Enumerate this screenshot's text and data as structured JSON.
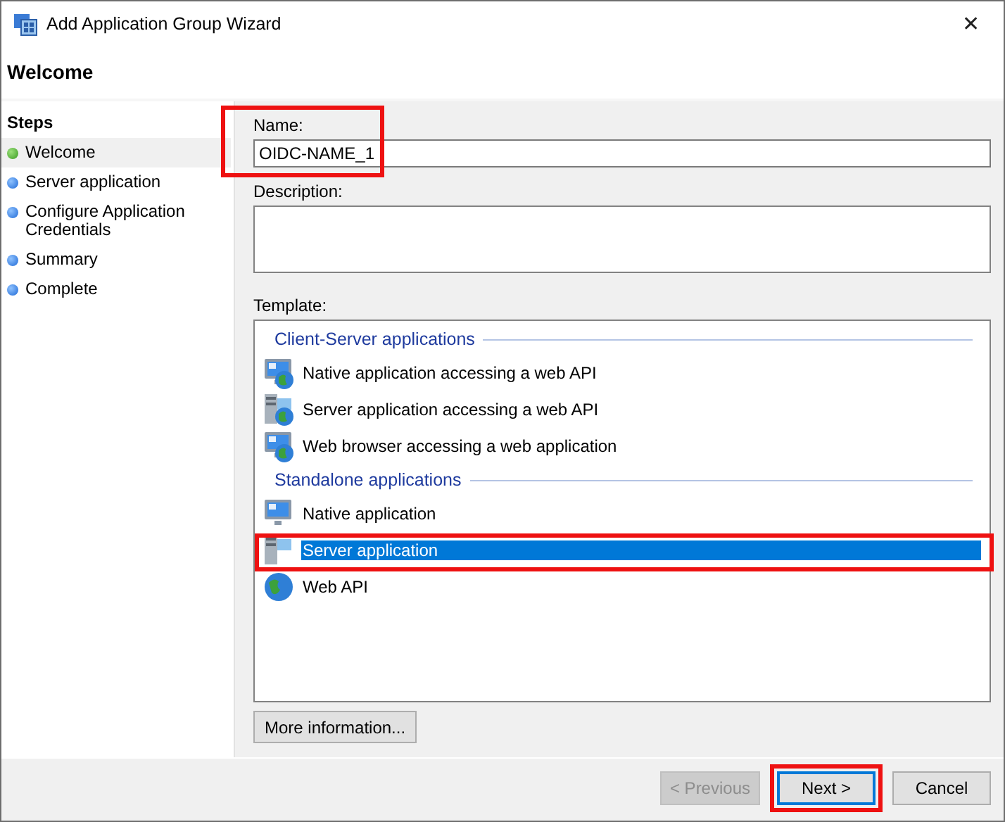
{
  "window": {
    "title": "Add Application Group Wizard",
    "close": "✕"
  },
  "page_title": "Welcome",
  "steps": {
    "heading": "Steps",
    "items": [
      {
        "label": "Welcome",
        "selected": true
      },
      {
        "label": "Server application",
        "selected": false
      },
      {
        "label": "Configure Application Credentials",
        "selected": false
      },
      {
        "label": "Summary",
        "selected": false
      },
      {
        "label": "Complete",
        "selected": false
      }
    ]
  },
  "name": {
    "label": "Name:",
    "value": "OIDC-NAME_1",
    "highlighted": true
  },
  "description": {
    "label": "Description:"
  },
  "template": {
    "label": "Template:",
    "groups": [
      {
        "heading": "Client-Server applications",
        "items": [
          {
            "label": "Native application accessing a web API",
            "kind": "monitor-globe",
            "selected": false,
            "highlighted": false
          },
          {
            "label": "Server application accessing a web API",
            "kind": "server-globe",
            "selected": false,
            "highlighted": false
          },
          {
            "label": "Web browser accessing a web application",
            "kind": "monitor-globe",
            "selected": false,
            "highlighted": false
          }
        ]
      },
      {
        "heading": "Standalone applications",
        "items": [
          {
            "label": "Native application",
            "kind": "monitor",
            "selected": false,
            "highlighted": false
          },
          {
            "label": "Server application",
            "kind": "server",
            "selected": true,
            "highlighted": true
          },
          {
            "label": "Web API",
            "kind": "globe",
            "selected": false,
            "highlighted": false
          }
        ]
      }
    ]
  },
  "more_info": "More information...",
  "buttons": [
    {
      "label": "< Previous",
      "disabled": true,
      "default": false,
      "highlighted": false
    },
    {
      "label": "Next >",
      "disabled": false,
      "default": true,
      "highlighted": true
    },
    {
      "label": "Cancel",
      "disabled": false,
      "default": false,
      "highlighted": false
    }
  ]
}
